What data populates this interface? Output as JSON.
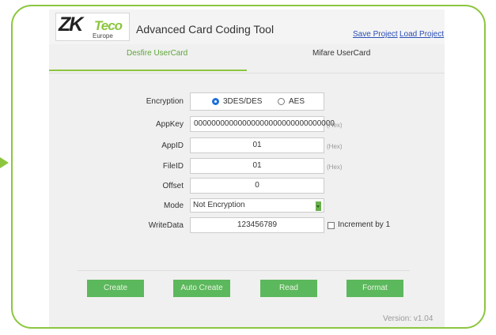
{
  "logo": {
    "zk": "ZK",
    "teco": "Teco",
    "region": "Europe"
  },
  "header": {
    "title": "Advanced Card Coding Tool",
    "save_project": "Save Project",
    "load_project": "Load Project"
  },
  "tabs": [
    {
      "label": "Desfire UserCard",
      "active": true
    },
    {
      "label": "Mifare UserCard",
      "active": false
    }
  ],
  "form": {
    "encryption": {
      "label": "Encryption",
      "options": [
        {
          "label": "3DES/DES",
          "selected": true
        },
        {
          "label": "AES",
          "selected": false
        }
      ]
    },
    "appkey": {
      "label": "AppKey",
      "value": "00000000000000000000000000000000",
      "hint": "(Hex)"
    },
    "appid": {
      "label": "AppID",
      "value": "01",
      "hint": "(Hex)"
    },
    "fileid": {
      "label": "FileID",
      "value": "01",
      "hint": "(Hex)"
    },
    "offset": {
      "label": "Offset",
      "value": "0"
    },
    "mode": {
      "label": "Mode",
      "value": "Not Encryption"
    },
    "writedata": {
      "label": "WriteData",
      "value": "123456789",
      "increment_label": "Increment by 1",
      "increment_checked": false
    }
  },
  "buttons": {
    "create": "Create",
    "auto_create": "Auto Create",
    "read": "Read",
    "format": "Format"
  },
  "version": "Version: v1.04",
  "colors": {
    "accent": "#8cc63f",
    "button": "#5cb85c",
    "link": "#2a4fb8",
    "radio": "#1e6fd9"
  },
  "icons": [
    "pointer-arrow-icon",
    "dropdown-arrow-icon"
  ]
}
